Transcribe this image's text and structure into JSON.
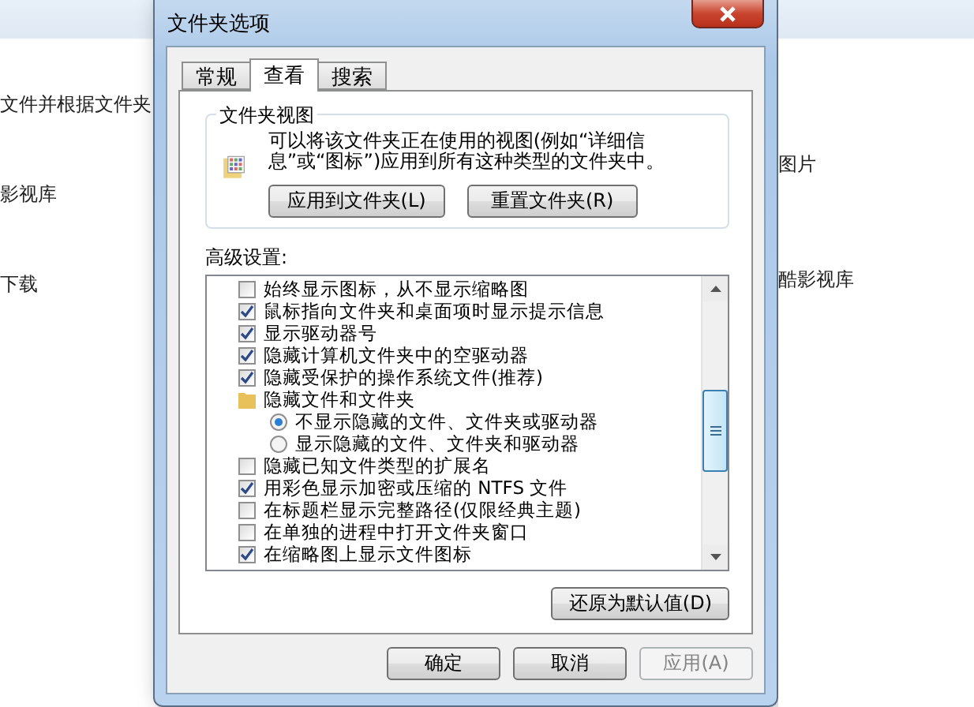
{
  "background": {
    "left_items": [
      "文件并根据文件夹",
      "影视库",
      "下载"
    ],
    "right_items": [
      "图片",
      "酷影视库"
    ]
  },
  "window": {
    "title": "文件夹选项"
  },
  "tabs": [
    {
      "label": "常规",
      "selected": false
    },
    {
      "label": "查看",
      "selected": true
    },
    {
      "label": "搜索",
      "selected": false
    }
  ],
  "folder_views": {
    "title": "文件夹视图",
    "description": "可以将该文件夹正在使用的视图(例如“详细信息”或“图标”)应用到所有这种类型的文件夹中。",
    "buttons": [
      "应用到文件夹(L)",
      "重置文件夹(R)"
    ]
  },
  "advanced": {
    "label": "高级设置:",
    "items": [
      {
        "kind": "checkbox",
        "label": "始终显示图标，从不显示缩略图",
        "checked": false
      },
      {
        "kind": "checkbox",
        "label": "鼠标指向文件夹和桌面项时显示提示信息",
        "checked": true
      },
      {
        "kind": "checkbox",
        "label": "显示驱动器号",
        "checked": true
      },
      {
        "kind": "checkbox",
        "label": "隐藏计算机文件夹中的空驱动器",
        "checked": true
      },
      {
        "kind": "checkbox",
        "label": "隐藏受保护的操作系统文件(推荐)",
        "checked": true
      },
      {
        "kind": "folder",
        "label": "隐藏文件和文件夹",
        "children": [
          {
            "kind": "radio",
            "label": "不显示隐藏的文件、文件夹或驱动器",
            "selected": true
          },
          {
            "kind": "radio",
            "label": "显示隐藏的文件、文件夹和驱动器",
            "selected": false
          }
        ]
      },
      {
        "kind": "checkbox",
        "label": "隐藏已知文件类型的扩展名",
        "checked": false
      },
      {
        "kind": "checkbox",
        "label": "用彩色显示加密或压缩的 NTFS 文件",
        "checked": true
      },
      {
        "kind": "checkbox",
        "label": "在标题栏显示完整路径(仅限经典主题)",
        "checked": false
      },
      {
        "kind": "checkbox",
        "label": "在单独的进程中打开文件夹窗口",
        "checked": false
      },
      {
        "kind": "checkbox",
        "label": "在缩略图上显示文件图标",
        "checked": true
      }
    ],
    "restore_button": "还原为默认值(D)"
  },
  "buttons": [
    {
      "label": "确定",
      "disabled": false
    },
    {
      "label": "取消",
      "disabled": false
    },
    {
      "label": "应用(A)",
      "disabled": true
    }
  ]
}
